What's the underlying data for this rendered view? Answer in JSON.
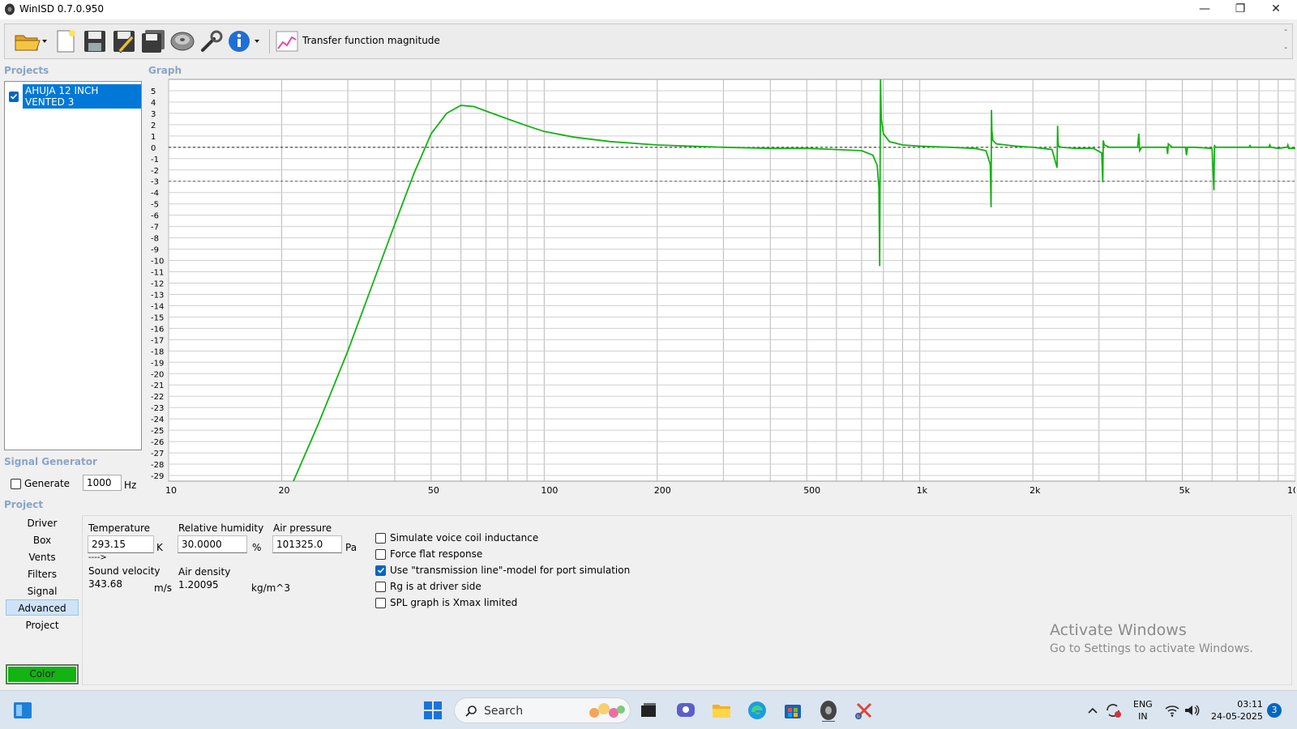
{
  "window": {
    "title": "WinISD 0.7.0.950",
    "controls": {
      "minimize": "—",
      "maximize": "❐",
      "close": "✕"
    }
  },
  "toolbar": {
    "graph_selector_label": "Transfer function magnitude",
    "icons": [
      "open-folder-icon",
      "new-project-icon",
      "save-icon",
      "save-as-icon",
      "save-all-icon",
      "driver-editor-icon",
      "tools-icon",
      "info-icon",
      "graph-type-icon"
    ],
    "dash_top": "-",
    "dash_bottom": "-"
  },
  "sections": {
    "projects": "Projects",
    "graph": "Graph",
    "signal_generator": "Signal Generator",
    "project": "Project"
  },
  "projects": [
    {
      "name": "AHUJA 12 INCH VENTED 3",
      "checked": true
    }
  ],
  "signal_generator": {
    "generate_label": "Generate",
    "generate_checked": false,
    "frequency": "1000",
    "unit": "Hz"
  },
  "project_nav": {
    "items": [
      "Driver",
      "Box",
      "Vents",
      "Filters",
      "Signal",
      "Advanced",
      "Project"
    ],
    "selected": "Advanced",
    "color_button": "Color",
    "color_value": "#12b312"
  },
  "advanced": {
    "temperature": {
      "label": "Temperature",
      "value": "293.15",
      "unit": "K"
    },
    "humidity": {
      "label": "Relative humidity",
      "value": "30.0000",
      "unit": "%"
    },
    "pressure": {
      "label": "Air pressure",
      "value": "101325.0",
      "unit": "Pa"
    },
    "arrow": "---->",
    "sound_velocity": {
      "label": "Sound velocity",
      "value": "343.68",
      "unit": "m/s"
    },
    "air_density": {
      "label": "Air density",
      "value": "1.20095",
      "unit": "kg/m^3"
    },
    "options": [
      {
        "label": "Simulate voice coil inductance",
        "checked": false
      },
      {
        "label": "Force flat response",
        "checked": false
      },
      {
        "label": "Use \"transmission line\"-model for port simulation",
        "checked": true
      },
      {
        "label": "Rg is at driver side",
        "checked": false
      },
      {
        "label": "SPL graph is Xmax limited",
        "checked": false
      }
    ]
  },
  "watermark": {
    "title": "Activate Windows",
    "subtitle": "Go to Settings to activate Windows."
  },
  "taskbar": {
    "search_placeholder": "Search",
    "tray": {
      "lang_top": "ENG",
      "lang_bottom": "IN",
      "time": "03:11",
      "date": "24-05-2025",
      "notifications": "3"
    }
  },
  "chart_data": {
    "type": "line",
    "xscale": "log",
    "xlim": [
      10,
      10000
    ],
    "ylim": [
      -29.5,
      6
    ],
    "x_ticks": [
      {
        "v": 10,
        "label": "10"
      },
      {
        "v": 20,
        "label": "20"
      },
      {
        "v": 50,
        "label": "50"
      },
      {
        "v": 100,
        "label": "100"
      },
      {
        "v": 200,
        "label": "200"
      },
      {
        "v": 500,
        "label": "500"
      },
      {
        "v": 1000,
        "label": "1k"
      },
      {
        "v": 2000,
        "label": "2k"
      },
      {
        "v": 5000,
        "label": "5k"
      },
      {
        "v": 10000,
        "label": "10k"
      }
    ],
    "y_ticks": [
      5,
      4,
      3,
      2,
      1,
      0,
      -1,
      -2,
      -3,
      -4,
      -5,
      -6,
      -7,
      -8,
      -9,
      -10,
      -11,
      -12,
      -13,
      -14,
      -15,
      -16,
      -17,
      -18,
      -19,
      -20,
      -21,
      -22,
      -23,
      -24,
      -25,
      -26,
      -27,
      -28,
      -29
    ],
    "reference_lines": [
      0,
      -3
    ],
    "series": [
      {
        "color": "#12b312",
        "x": [
          21.5,
          25,
          30,
          35,
          40,
          45,
          50,
          55,
          60,
          65,
          70,
          80,
          90,
          100,
          120,
          150,
          200,
          300,
          400,
          500,
          600,
          700,
          750,
          770,
          778,
          782,
          786,
          790,
          800,
          830,
          900,
          1000,
          1200,
          1400,
          1500,
          1540,
          1548,
          1552,
          1556,
          1565,
          1600,
          1800,
          2000,
          2250,
          2320,
          2328,
          2333,
          2340,
          2380,
          2600,
          2900,
          3050,
          3070,
          3080,
          3100,
          3200,
          3500,
          3800,
          3830,
          3850,
          3900,
          4200,
          4550,
          4570,
          4590,
          4700,
          5100,
          5130,
          5160,
          5400,
          6000,
          6070,
          6090,
          6120,
          6500,
          7000,
          7550,
          7570,
          7600,
          8000,
          8500,
          8550,
          8600,
          9000,
          9500,
          9550,
          9600,
          10000
        ],
        "y": [
          -29.5,
          -24.5,
          -18,
          -12,
          -6.8,
          -2.3,
          1.2,
          3.0,
          3.7,
          3.6,
          3.2,
          2.5,
          1.9,
          1.4,
          0.9,
          0.5,
          0.2,
          0.0,
          -0.1,
          -0.1,
          -0.2,
          -0.3,
          -0.7,
          -1.6,
          -3.5,
          -10.5,
          6.0,
          2.5,
          1.2,
          0.5,
          0.2,
          0.1,
          0.0,
          -0.1,
          -0.3,
          -1.5,
          -5.3,
          3.3,
          1.5,
          0.6,
          0.3,
          0.1,
          0.0,
          -0.2,
          -1.8,
          1.9,
          0.6,
          0.1,
          0.0,
          -0.1,
          -0.1,
          -0.5,
          -3.1,
          0.6,
          0.2,
          0.0,
          0.0,
          0.0,
          1.2,
          -0.3,
          0.0,
          0.0,
          0.0,
          -0.6,
          0.3,
          0.0,
          0.0,
          -0.7,
          0.0,
          0.0,
          -0.1,
          -3.8,
          0.2,
          0.0,
          0.0,
          0.0,
          0.0,
          0.2,
          0.0,
          0.0,
          0.0,
          0.2,
          0.0,
          -0.1,
          0.0,
          0.2,
          -0.1,
          -0.1
        ]
      }
    ]
  }
}
